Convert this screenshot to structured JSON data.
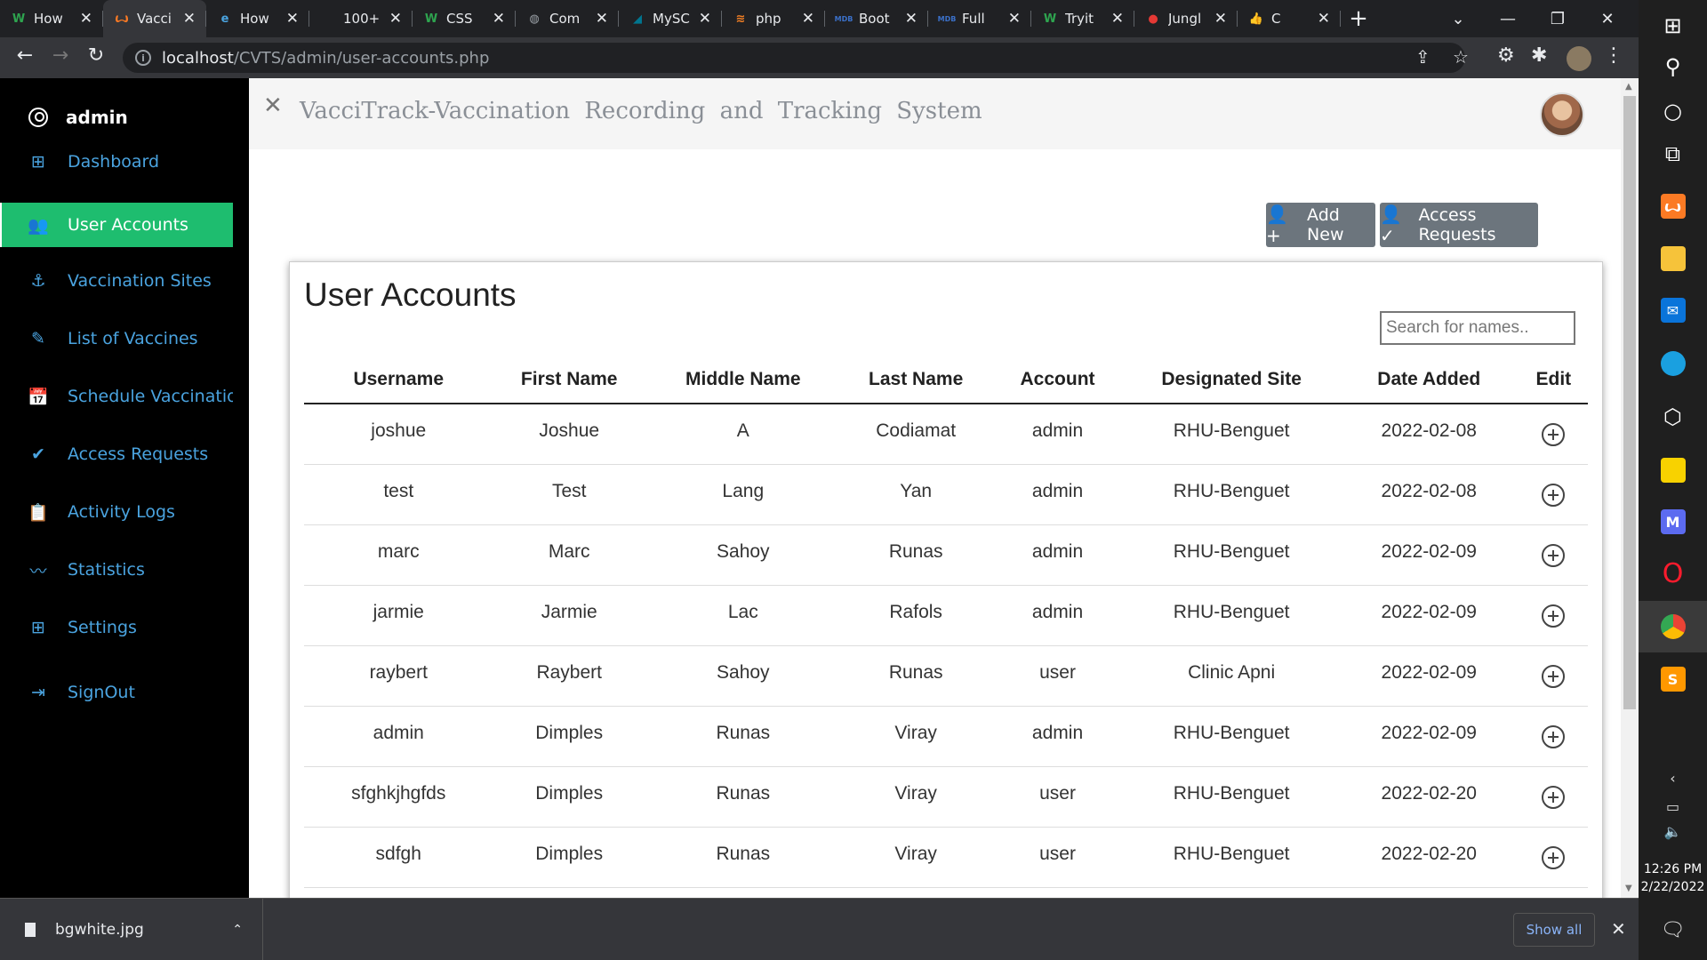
{
  "browser": {
    "tabs": [
      {
        "title": "How",
        "icon": "w-icon",
        "color": "#2ea44f"
      },
      {
        "title": "Vacci",
        "icon": "xampp-icon",
        "color": "#fb7a24",
        "active": true
      },
      {
        "title": "How",
        "icon": "e-icon",
        "color": "#4aa3df"
      },
      {
        "title": "100+",
        "icon": "blank-icon",
        "color": "#202124"
      },
      {
        "title": "CSS",
        "icon": "w-icon",
        "color": "#2ea44f"
      },
      {
        "title": "Com",
        "icon": "globe-icon",
        "color": "#9aa0a6"
      },
      {
        "title": "MySC",
        "icon": "mysql-icon",
        "color": "#00758f"
      },
      {
        "title": "php",
        "icon": "stackoverflow-icon",
        "color": "#f48024"
      },
      {
        "title": "Boot",
        "icon": "mdb-icon",
        "color": "#3b71ca"
      },
      {
        "title": "Full",
        "icon": "mdb-icon",
        "color": "#3b71ca"
      },
      {
        "title": "Tryit",
        "icon": "w-icon",
        "color": "#2ea44f"
      },
      {
        "title": "Jungl",
        "icon": "record-icon",
        "color": "#e53935"
      },
      {
        "title": "C",
        "icon": "thumbs-icon",
        "color": "#f5c518"
      }
    ],
    "url_host": "localhost",
    "url_path": "/CVTS/admin/user-accounts.php"
  },
  "sidebar": {
    "user": "admin",
    "items": [
      {
        "label": "Dashboard",
        "icon": "grid-icon",
        "active": false
      },
      {
        "label": "User Accounts",
        "icon": "users-icon",
        "active": true
      },
      {
        "label": "Vaccination Sites",
        "icon": "anchor-icon",
        "active": false
      },
      {
        "label": "List of Vaccines",
        "icon": "syringe-icon",
        "active": false
      },
      {
        "label": "Schedule Vaccination",
        "icon": "calendar-check-icon",
        "active": false
      },
      {
        "label": "Access Requests",
        "icon": "user-check-icon",
        "active": false
      },
      {
        "label": "Activity Logs",
        "icon": "clipboard-icon",
        "active": false
      },
      {
        "label": "Statistics",
        "icon": "pulse-icon",
        "active": false
      },
      {
        "label": "Settings",
        "icon": "settings-grid-icon",
        "active": false
      },
      {
        "label": "SignOut",
        "icon": "sign-out-icon",
        "active": false
      }
    ],
    "active_color": "#1ebd6f",
    "link_color": "#4aa3df"
  },
  "header": {
    "title": "VacciTrack-Vaccination Recording and Tracking System"
  },
  "actions": {
    "add_new": "Add New",
    "access_requests": "Access Requests"
  },
  "card": {
    "title": "User Accounts",
    "search_placeholder": "Search for names.."
  },
  "table": {
    "columns": [
      "Username",
      "First Name",
      "Middle Name",
      "Last Name",
      "Account",
      "Designated Site",
      "Date Added",
      "Edit"
    ],
    "rows": [
      [
        "joshue",
        "Joshue",
        "A",
        "Codiamat",
        "admin",
        "RHU-Benguet",
        "2022-02-08"
      ],
      [
        "test",
        "Test",
        "Lang",
        "Yan",
        "admin",
        "RHU-Benguet",
        "2022-02-08"
      ],
      [
        "marc",
        "Marc",
        "Sahoy",
        "Runas",
        "admin",
        "RHU-Benguet",
        "2022-02-09"
      ],
      [
        "jarmie",
        "Jarmie",
        "Lac",
        "Rafols",
        "admin",
        "RHU-Benguet",
        "2022-02-09"
      ],
      [
        "raybert",
        "Raybert",
        "Sahoy",
        "Runas",
        "user",
        "Clinic Apni",
        "2022-02-09"
      ],
      [
        "admin",
        "Dimples",
        "Runas",
        "Viray",
        "admin",
        "RHU-Benguet",
        "2022-02-09"
      ],
      [
        "sfghkjhgfds",
        "Dimples",
        "Runas",
        "Viray",
        "user",
        "RHU-Benguet",
        "2022-02-20"
      ],
      [
        "sdfgh",
        "Dimples",
        "Runas",
        "Viray",
        "user",
        "RHU-Benguet",
        "2022-02-20"
      ]
    ]
  },
  "downloads": {
    "file": "bgwhite.jpg",
    "show_all": "Show all"
  },
  "taskbar": {
    "time": "12:26 PM",
    "date": "2/22/2022"
  }
}
